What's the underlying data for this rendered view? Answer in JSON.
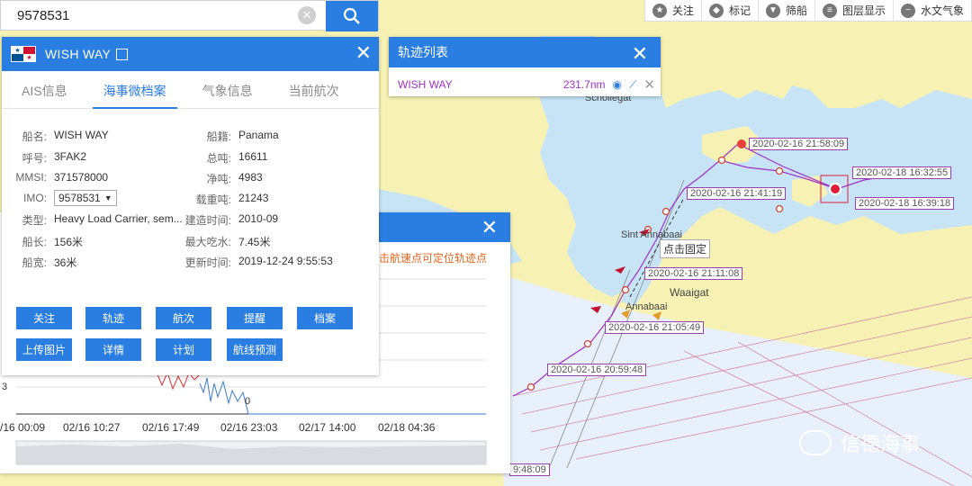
{
  "search": {
    "value": "9578531"
  },
  "toolbar": {
    "items": [
      {
        "icon": "star-icon",
        "label": "关注"
      },
      {
        "icon": "tag-icon",
        "label": "标记"
      },
      {
        "icon": "filter-icon",
        "label": "筛船"
      },
      {
        "icon": "layers-icon",
        "label": "图层显示"
      },
      {
        "icon": "wave-icon",
        "label": "水文气象"
      }
    ]
  },
  "ship": {
    "name": "WISH WAY",
    "flag_colors": {
      "red": "#d21034",
      "blue": "#005293",
      "white": "#ffffff"
    },
    "tabs": [
      "AIS信息",
      "海事微档案",
      "气象信息",
      "当前航次"
    ],
    "active_tab": "海事微档案",
    "left": [
      {
        "k": "船名:",
        "v": "WISH WAY"
      },
      {
        "k": "呼号:",
        "v": "3FAK2"
      },
      {
        "k": "MMSI:",
        "v": "371578000"
      },
      {
        "k": "IMO:",
        "v": "9578531"
      },
      {
        "k": "类型:",
        "v": "Heavy Load Carrier, sem..."
      },
      {
        "k": "船长:",
        "v": "156米"
      },
      {
        "k": "船宽:",
        "v": "36米"
      }
    ],
    "right": [
      {
        "k": "船籍:",
        "v": "Panama"
      },
      {
        "k": "总吨:",
        "v": "16611"
      },
      {
        "k": "净吨:",
        "v": "4983"
      },
      {
        "k": "载重吨:",
        "v": "21243"
      },
      {
        "k": "建造时间:",
        "v": "2010-09"
      },
      {
        "k": "最大吃水:",
        "v": "7.45米"
      },
      {
        "k": "更新时间:",
        "v": "2019-12-24 9:55:53"
      }
    ],
    "buttons": [
      "关注",
      "轨迹",
      "航次",
      "提醒",
      "档案",
      "上传图片",
      "详情",
      "计划",
      "航线预测"
    ]
  },
  "track_list": {
    "title": "轨迹列表",
    "item": {
      "name": "WISH WAY",
      "distance": "231.7nm"
    }
  },
  "speed_chart": {
    "hint": "击航速点可定位轨迹点",
    "x_labels": [
      "/16 00:09",
      "02/16 10:27",
      "02/16 17:49",
      "02/16 23:03",
      "02/17 14:00",
      "02/18 04:36"
    ],
    "y_label": "3",
    "zero_label": "0"
  },
  "map": {
    "place_names": [
      "Schollegat",
      "Sint Annabaai",
      "Waaigat",
      "Annabaai"
    ],
    "track_labels": [
      "2020-02-16 21:58:09",
      "2020-02-18 16:32:55",
      "2020-02-16 21:41:19",
      "2020-02-18 16:39:18",
      "2020-02-16 21:11:08",
      "2020-02-16 21:05:49",
      "2020-02-16 20:59:48",
      "9:48:09"
    ],
    "fix_label": "点击固定",
    "track_color": "#a030c8",
    "land_color": "#f7f2b4",
    "water_color": "#c6e4f6"
  },
  "watermark": "信德海事"
}
